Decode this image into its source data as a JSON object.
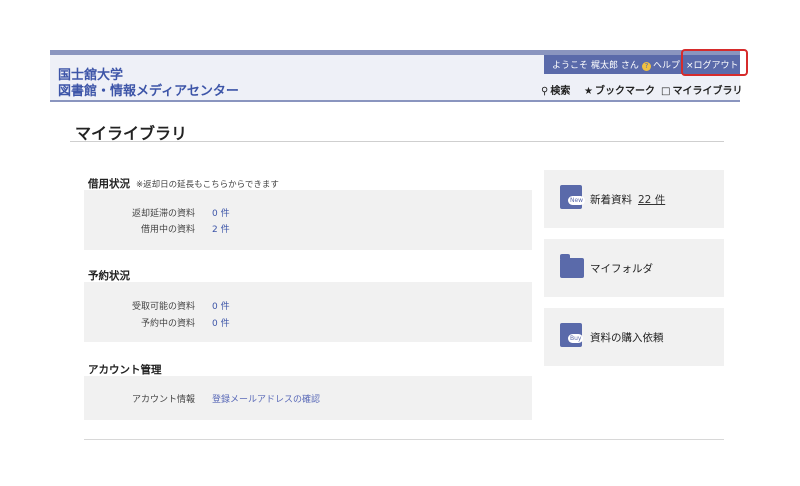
{
  "header": {
    "university": "国士舘大学",
    "library": "図書館・情報メディアセンター"
  },
  "userbar": {
    "welcome": "ようこそ 梶",
    "user_name": "太郎 さん",
    "help": "ヘルプ",
    "logout": "×ログアウト"
  },
  "subnav": {
    "search": "検索",
    "bookmark": "ブックマーク",
    "my_library": "マイライブラリ"
  },
  "page_title": "マイライブラリ",
  "lending": {
    "title": "借用状況",
    "note": "※返却日の延長もこちらからできます",
    "rows": [
      {
        "label": "返却延滞の資料",
        "value": "0 件"
      },
      {
        "label": "借用中の資料",
        "value": "2 件"
      }
    ]
  },
  "reservation": {
    "title": "予約状況",
    "rows": [
      {
        "label": "受取可能の資料",
        "value": "0 件"
      },
      {
        "label": "予約中の資料",
        "value": "0 件"
      }
    ]
  },
  "account": {
    "title": "アカウント管理",
    "rows": [
      {
        "label": "アカウント情報",
        "value": "登録メールアドレスの確認"
      }
    ]
  },
  "cards": {
    "new_items": {
      "label": "新着資料",
      "count": "22 件",
      "icon": "new-book-icon",
      "tag": "New"
    },
    "my_folder": {
      "label": "マイフォルダ",
      "icon": "folder-icon"
    },
    "purchase": {
      "label": "資料の購入依頼",
      "icon": "buy-book-icon",
      "tag": "Buy"
    }
  },
  "colors": {
    "brand": "#5a6aaa",
    "highlight": "#d62b2b",
    "link": "#3d55a8"
  }
}
